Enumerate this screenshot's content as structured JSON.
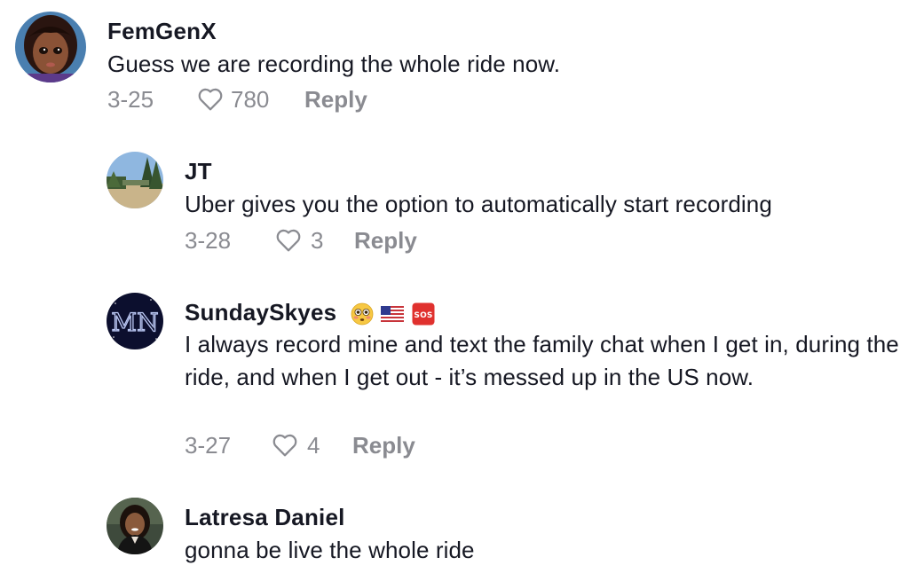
{
  "comments": [
    {
      "username": "FemGenX",
      "text": "Guess we are recording the whole ride now.",
      "date": "3-25",
      "likes": "780",
      "reply_label": "Reply",
      "badges": []
    },
    {
      "username": "JT",
      "text": "Uber gives you the option to automatically start recording",
      "date": "3-28",
      "likes": "3",
      "reply_label": "Reply",
      "badges": []
    },
    {
      "username": "SundaySkyes",
      "text": "I always record mine and text the family chat when I get in, during the ride, and when I get out - it’s messed up in the US now.",
      "date": "3-27",
      "likes": "4",
      "reply_label": "Reply",
      "badges": [
        "flushed-face-emoji",
        "us-flag-emoji",
        "sos-emoji"
      ],
      "avatar_text": "MN"
    },
    {
      "username": "Latresa Daniel",
      "text": "gonna be live the whole ride",
      "badges": []
    }
  ],
  "colors": {
    "text": "#161823",
    "meta": "#8a8b91",
    "sos_red": "#e0312e"
  }
}
